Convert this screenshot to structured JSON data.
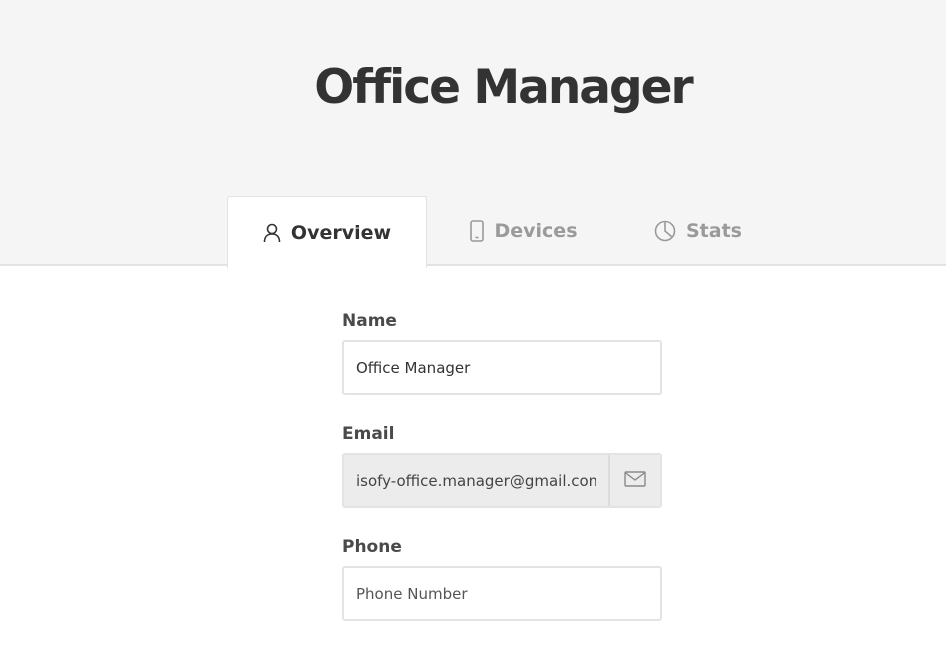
{
  "header": {
    "title": "Office Manager"
  },
  "tabs": [
    {
      "label": "Overview",
      "icon": "user-icon",
      "active": true
    },
    {
      "label": "Devices",
      "icon": "phone-icon",
      "active": false
    },
    {
      "label": "Stats",
      "icon": "pie-chart-icon",
      "active": false
    }
  ],
  "form": {
    "name": {
      "label": "Name",
      "value": "Office Manager"
    },
    "email": {
      "label": "Email",
      "value": "isofy-office.manager@gmail.com",
      "addon_icon": "mail-icon"
    },
    "phone": {
      "label": "Phone",
      "value": "",
      "placeholder": "Phone Number"
    }
  },
  "colors": {
    "header_bg": "#f5f5f5",
    "text_dark": "#333333",
    "text_muted": "#9a9a9a",
    "border": "#e3e3e3",
    "readonly_bg": "#ececec"
  }
}
